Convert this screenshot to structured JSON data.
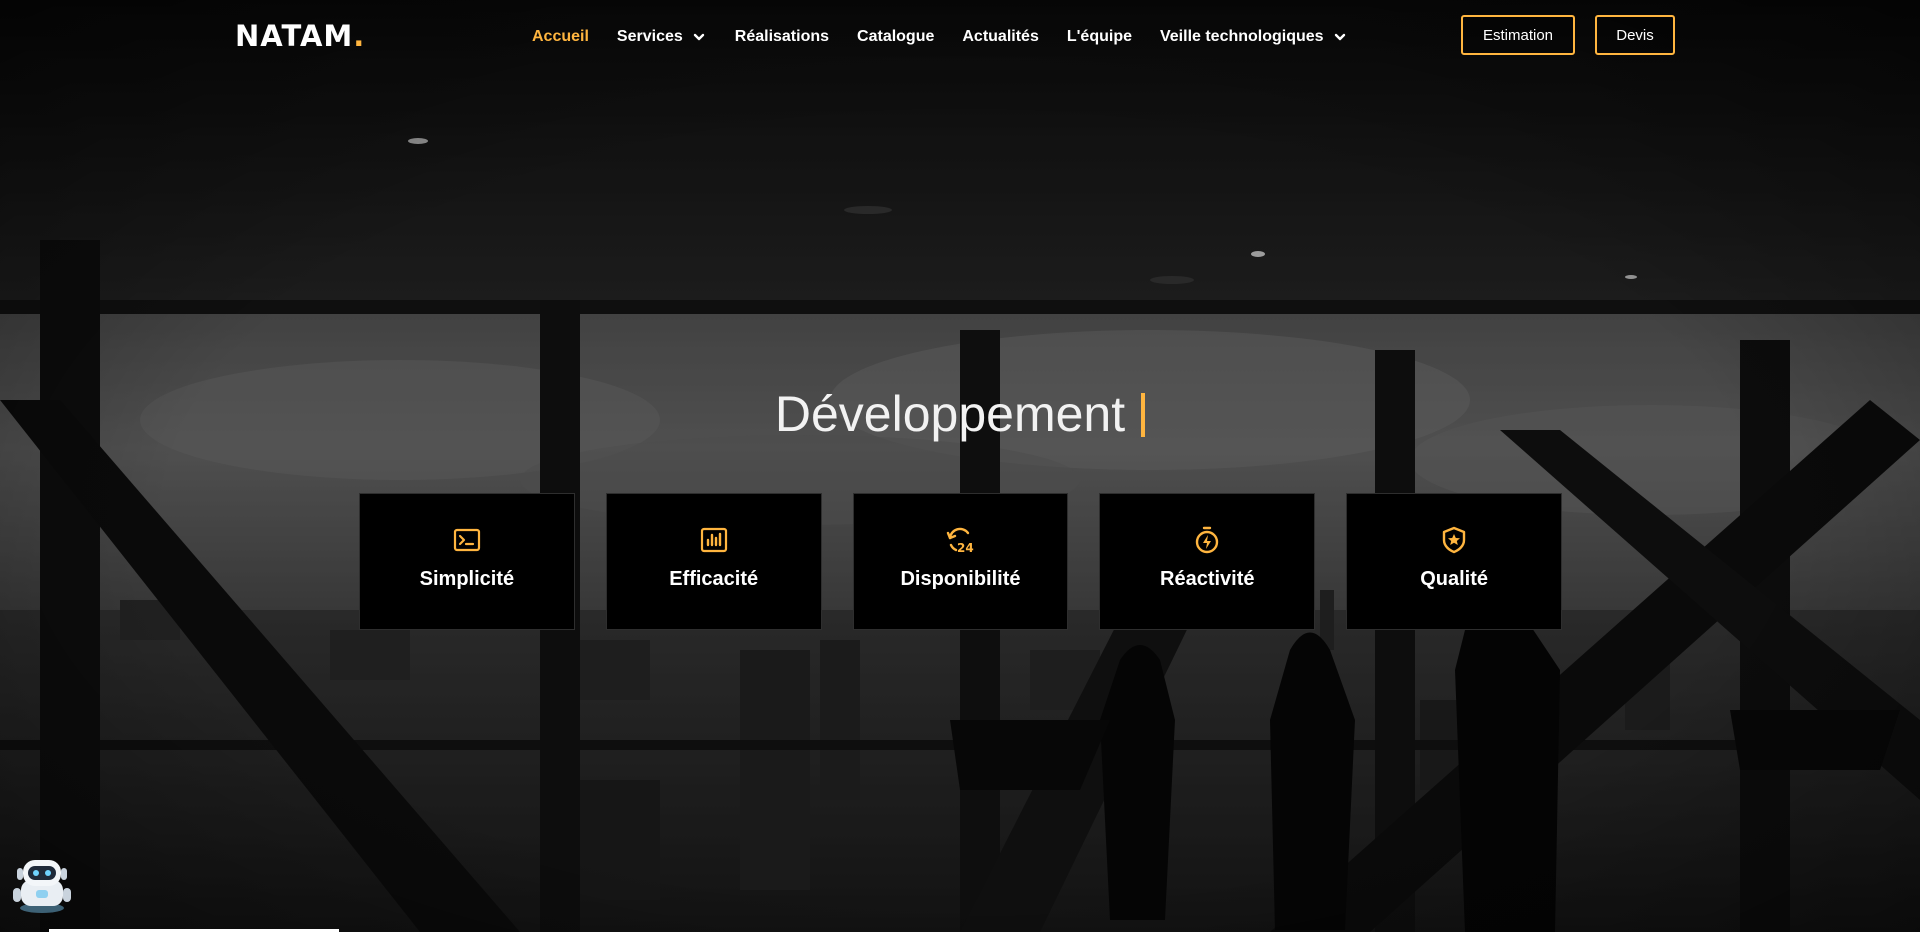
{
  "brand": {
    "name": "NATAM",
    "dot": ".",
    "accent_color": "#ffb53f"
  },
  "nav": {
    "items": [
      {
        "label": "Accueil",
        "active": true,
        "has_dropdown": false
      },
      {
        "label": "Services",
        "active": false,
        "has_dropdown": true
      },
      {
        "label": "Réalisations",
        "active": false,
        "has_dropdown": false
      },
      {
        "label": "Catalogue",
        "active": false,
        "has_dropdown": false
      },
      {
        "label": "Actualités",
        "active": false,
        "has_dropdown": false
      },
      {
        "label": "L'équipe",
        "active": false,
        "has_dropdown": false
      },
      {
        "label": "Veille technologiques",
        "active": false,
        "has_dropdown": true
      }
    ],
    "estimation_label": "Estimation",
    "devis_label": "Devis"
  },
  "hero": {
    "headline": "Développement"
  },
  "features": [
    {
      "label": "Simplicité",
      "icon": "terminal-icon"
    },
    {
      "label": "Efficacité",
      "icon": "bar-chart-icon"
    },
    {
      "label": "Disponibilité",
      "icon": "refresh-24-icon"
    },
    {
      "label": "Réactivité",
      "icon": "stopwatch-bolt-icon"
    },
    {
      "label": "Qualité",
      "icon": "shield-star-icon"
    }
  ],
  "chatbot": {
    "icon": "robot-icon"
  }
}
